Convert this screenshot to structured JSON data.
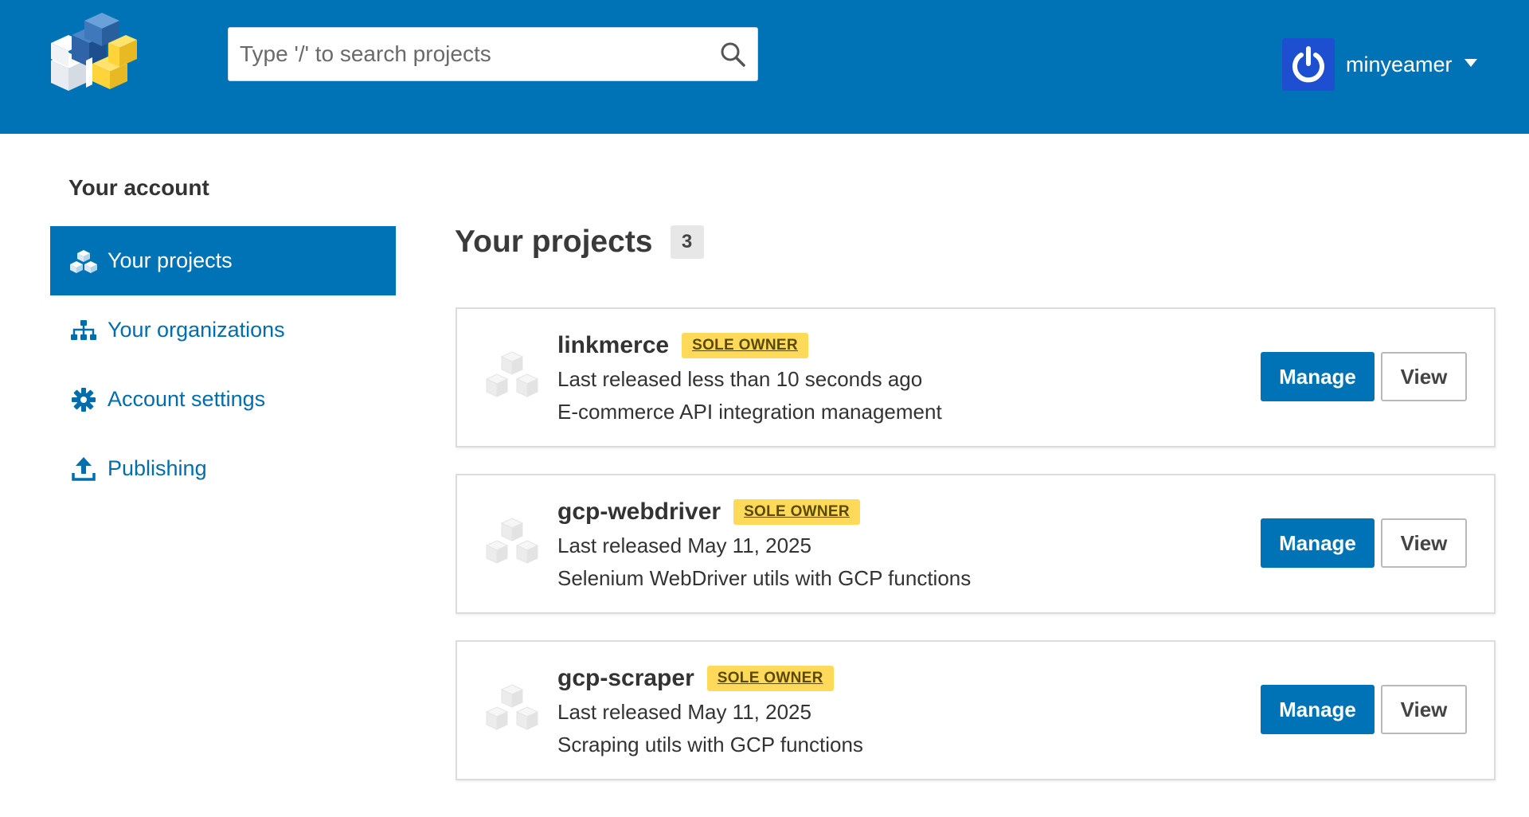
{
  "header": {
    "logo_icon": "pypi-logo-icon",
    "search": {
      "placeholder": "Type '/' to search projects",
      "value": "",
      "icon": "search-icon"
    },
    "user": {
      "name": "minyeamer",
      "avatar_icon": "power-icon",
      "caret_icon": "caret-down-icon"
    },
    "colors": {
      "brand": "#0073b7",
      "avatar_bg": "#1f4fd1"
    }
  },
  "sidebar": {
    "title": "Your account",
    "items": [
      {
        "label": "Your projects",
        "icon": "cubes-icon",
        "active": true
      },
      {
        "label": "Your organizations",
        "icon": "sitemap-icon",
        "active": false
      },
      {
        "label": "Account settings",
        "icon": "gear-icon",
        "active": false
      },
      {
        "label": "Publishing",
        "icon": "upload-icon",
        "active": false
      }
    ]
  },
  "main": {
    "title": "Your projects",
    "count": "3",
    "projects": [
      {
        "name": "linkmerce",
        "badge": "SOLE OWNER",
        "released": "Last released less than 10 seconds ago",
        "description": "E-commerce API integration management",
        "manage_label": "Manage",
        "view_label": "View"
      },
      {
        "name": "gcp-webdriver",
        "badge": "SOLE OWNER",
        "released": "Last released May 11, 2025",
        "description": "Selenium WebDriver utils with GCP functions",
        "manage_label": "Manage",
        "view_label": "View"
      },
      {
        "name": "gcp-scraper",
        "badge": "SOLE OWNER",
        "released": "Last released May 11, 2025",
        "description": "Scraping utils with GCP functions",
        "manage_label": "Manage",
        "view_label": "View"
      }
    ],
    "project_icon": "package-cubes-icon",
    "badge_color": "#ffd95a"
  }
}
